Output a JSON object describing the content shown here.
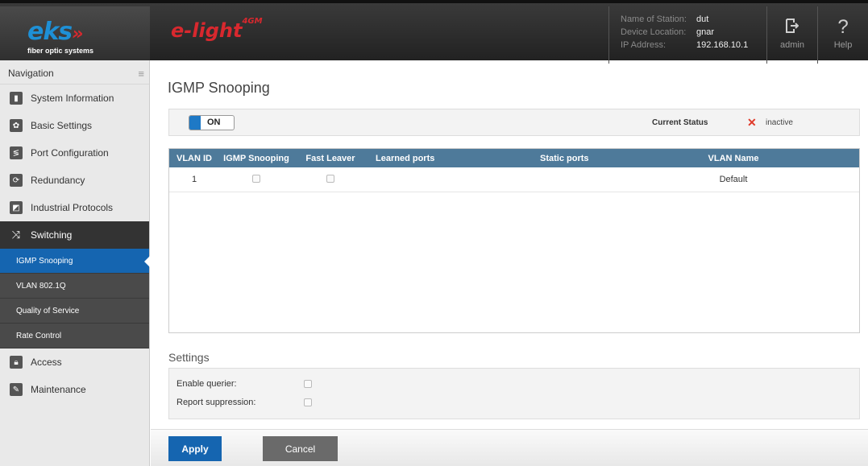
{
  "header": {
    "logo": "eks",
    "logo_tagline": "fiber optic systems",
    "product_name": "e-light",
    "product_sup": "4GM",
    "station": [
      {
        "key": "Name of Station:",
        "value": "dut"
      },
      {
        "key": "Device Location:",
        "value": "gnar"
      },
      {
        "key": "IP Address:",
        "value": "192.168.10.1"
      }
    ],
    "user_label": "admin",
    "user_icon": "logout-icon",
    "help_label": "Help",
    "help_icon": "?"
  },
  "sidebar": {
    "title": "Navigation",
    "items": [
      {
        "label": "System Information",
        "icon": "chart-icon"
      },
      {
        "label": "Basic Settings",
        "icon": "gear-icon"
      },
      {
        "label": "Port Configuration",
        "icon": "port-icon"
      },
      {
        "label": "Redundancy",
        "icon": "redundancy-icon"
      },
      {
        "label": "Industrial Protocols",
        "icon": "protocol-icon"
      },
      {
        "label": "Switching",
        "icon": "switch-icon"
      },
      {
        "label": "Access",
        "icon": "lock-icon"
      },
      {
        "label": "Maintenance",
        "icon": "wrench-icon"
      }
    ],
    "sub_items": [
      "IGMP Snooping",
      "VLAN 802.1Q",
      "Quality of Service",
      "Rate Control"
    ]
  },
  "main": {
    "title": "IGMP Snooping",
    "toggle_label": "ON",
    "current_status_label": "Current Status",
    "current_status_value": "inactive",
    "table": {
      "headers": [
        "VLAN ID",
        "IGMP Snooping",
        "Fast Leaver",
        "Learned ports",
        "Static ports",
        "VLAN Name"
      ],
      "rows": [
        {
          "vlan_id": "1",
          "igmp_snooping": false,
          "fast_leaver": false,
          "learned_ports": "",
          "static_ports": "",
          "vlan_name": "Default"
        }
      ]
    },
    "settings_title": "Settings",
    "settings": [
      {
        "label": "Enable querier:",
        "checked": false
      },
      {
        "label": "Report suppression:",
        "checked": false
      }
    ],
    "apply_label": "Apply",
    "cancel_label": "Cancel"
  },
  "colors": {
    "accent": "#1565b0",
    "table_header": "#4e7a9a",
    "status_inactive": "#e03a2a"
  }
}
